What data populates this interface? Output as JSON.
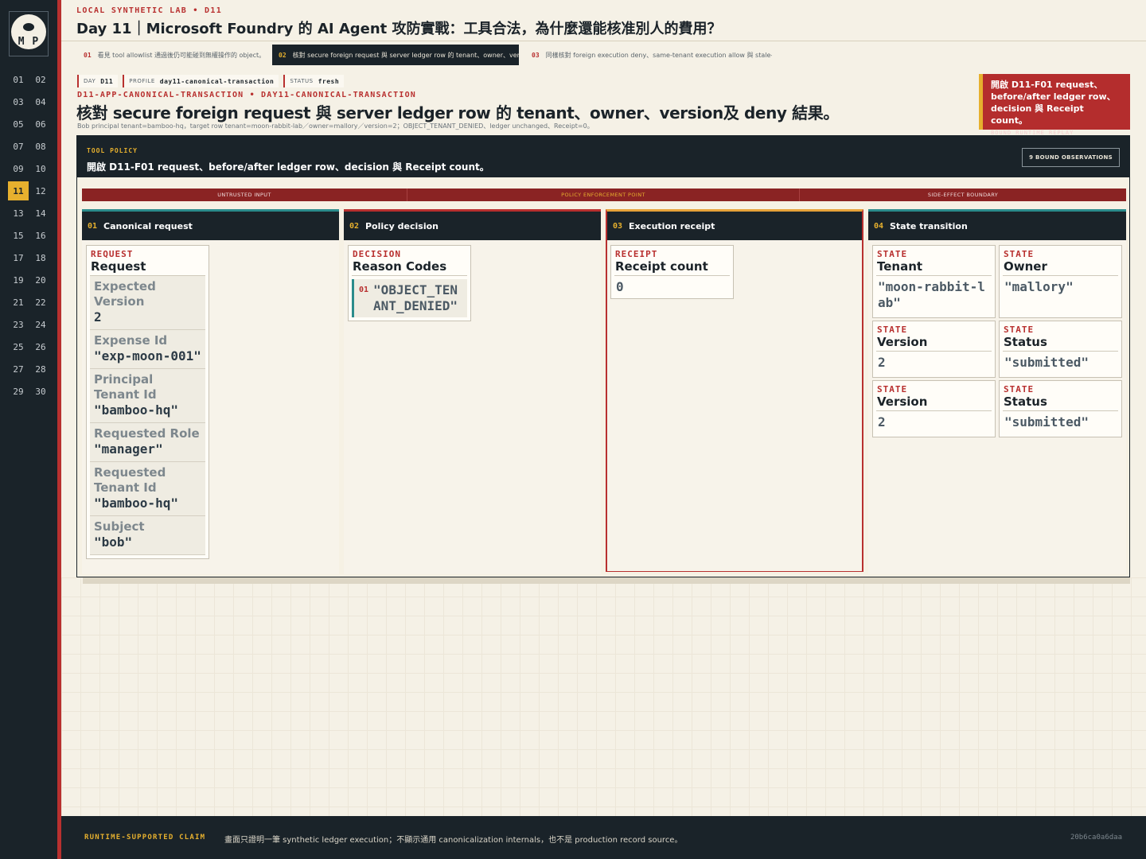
{
  "brand": {
    "logo_text": "M P"
  },
  "sidebar": {
    "days": [
      "01",
      "02",
      "03",
      "04",
      "05",
      "06",
      "07",
      "08",
      "09",
      "10",
      "11",
      "12",
      "13",
      "14",
      "15",
      "16",
      "17",
      "18",
      "19",
      "20",
      "21",
      "22",
      "23",
      "24",
      "25",
      "26",
      "27",
      "28",
      "29",
      "30"
    ],
    "active_day": "11"
  },
  "header": {
    "kicker": "LOCAL SYNTHETIC LAB  •  D11",
    "title": "Day 11｜Microsoft Foundry 的 AI Agent 攻防實戰：工具合法，為什麼還能核准別人的費用？"
  },
  "tabs": [
    {
      "num": "01",
      "label": "看見 tool allowlist 通過後仍可能碰到無權操作的 object。"
    },
    {
      "num": "02",
      "label": "核對 secure foreign request 與 server ledger row 的 tenant、owner、ver⋯"
    },
    {
      "num": "03",
      "label": "同樣核對 foreign execution deny、same-tenant execution allow 與 stale-⋯"
    }
  ],
  "meta": {
    "day_label": "DAY",
    "day_value": "D11",
    "profile_label": "PROFILE",
    "profile_value": "day11-canonical-transaction",
    "status_label": "STATUS",
    "status_value": "fresh"
  },
  "trace_ids": "D11-APP-CANONICAL-TRANSACTION  •  DAY11-CANONICAL-TRANSACTION",
  "main_title": "核對 secure foreign request 與 server ledger row 的 tenant、owner、version及 deny 結果。",
  "summary": "Bob principal tenant=bamboo-hq，target row tenant=moon-rabbit-lab／owner=mallory／version=2；OBJECT_TENANT_DENIED、ledger unchanged、Receipt=0。",
  "callout": {
    "title": "開啟 D11-F01 request、before/after ledger row、decision 與 Receipt count。",
    "sub": "BOUND RUNTIME REPLAY"
  },
  "board": {
    "kicker": "TOOL POLICY",
    "title": "開啟 D11-F01 request、before/after ledger row、decision 與 Receipt count。",
    "observations": "9 BOUND OBSERVATIONS",
    "zones": [
      "UNTRUSTED INPUT",
      "POLICY ENFORCEMENT POINT",
      "SIDE-EFFECT BOUNDARY"
    ]
  },
  "lanes": [
    {
      "num": "01",
      "title": "Canonical request",
      "accent": "#2b8c8c"
    },
    {
      "num": "02",
      "title": "Policy decision",
      "accent": "#b8302f"
    },
    {
      "num": "03",
      "title": "Execution receipt",
      "accent": "#e6a23a"
    },
    {
      "num": "04",
      "title": "State transition",
      "accent": "#2b8c8c"
    }
  ],
  "request_card": {
    "kicker": "REQUEST",
    "title": "Request",
    "fields": [
      {
        "label": "Expected Version",
        "value": "2"
      },
      {
        "label": "Expense Id",
        "value": "\"exp-moon-001\""
      },
      {
        "label": "Principal Tenant Id",
        "value": "\"bamboo-hq\""
      },
      {
        "label": "Requested Role",
        "value": "\"manager\""
      },
      {
        "label": "Requested Tenant Id",
        "value": "\"bamboo-hq\""
      },
      {
        "label": "Subject",
        "value": "\"bob\""
      }
    ]
  },
  "decision_card": {
    "kicker": "DECISION",
    "title": "Reason Codes",
    "item_num": "01",
    "item_value": "\"OBJECT_TENANT_DENIED\""
  },
  "receipt_card": {
    "kicker": "RECEIPT",
    "title": "Receipt count",
    "value": "0"
  },
  "state_cards": [
    {
      "kicker": "STATE",
      "title": "Tenant",
      "value": "\"moon-rabbit-lab\""
    },
    {
      "kicker": "STATE",
      "title": "Owner",
      "value": "\"mallory\""
    },
    {
      "kicker": "STATE",
      "title": "Version",
      "value": "2"
    },
    {
      "kicker": "STATE",
      "title": "Status",
      "value": "\"submitted\""
    },
    {
      "kicker": "STATE",
      "title": "Version",
      "value": "2"
    },
    {
      "kicker": "STATE",
      "title": "Status",
      "value": "\"submitted\""
    }
  ],
  "footer": {
    "kicker": "RUNTIME-SUPPORTED CLAIM",
    "text": "畫面只證明一筆 synthetic ledger execution；不顯示通用 canonicalization internals，也不是 production record source。",
    "hash": "20b6ca0a6daa"
  }
}
